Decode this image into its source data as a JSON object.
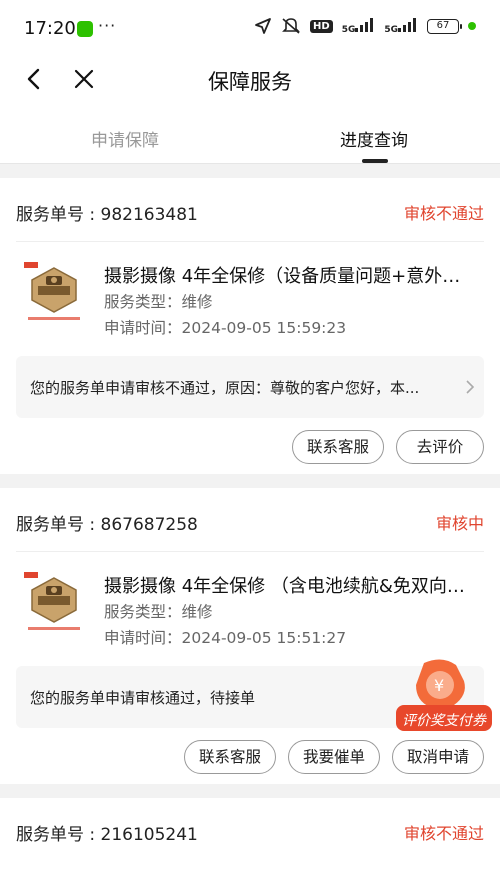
{
  "status_bar": {
    "time": "17:20",
    "more": "···",
    "hd": "HD",
    "signal1": "5G",
    "signal2": "5G",
    "battery": "67"
  },
  "nav": {
    "title": "保障服务"
  },
  "tabs": [
    {
      "label": "申请保障"
    },
    {
      "label": "进度查询"
    }
  ],
  "orders": [
    {
      "order_no": "服务单号 : 982163481",
      "status": "审核不通过",
      "product_title": "摄影摄像 4年全保修（设备质量问题+意外…",
      "service_type": "服务类型：维修",
      "apply_time": "申请时间：2024-09-05 15:59:23",
      "notice": "您的服务单申请审核不通过，原因：尊敬的客户您好，本...",
      "buttons": [
        "联系客服",
        "去评价"
      ]
    },
    {
      "order_no": "服务单号 : 867687258",
      "status": "审核中",
      "product_title": "摄影摄像 4年全保修 （含电池续航&免双向…",
      "service_type": "服务类型：维修",
      "apply_time": "申请时间：2024-09-05 15:51:27",
      "notice": "您的服务单申请审核通过，待接单",
      "buttons": [
        "联系客服",
        "我要催单",
        "取消申请"
      ]
    },
    {
      "order_no": "服务单号 : 216105241",
      "status": "审核不通过"
    }
  ],
  "coupon": {
    "label": "评价奖支付券"
  },
  "colors": {
    "status_red": "#e0452f",
    "background": "#f2f2f2"
  }
}
